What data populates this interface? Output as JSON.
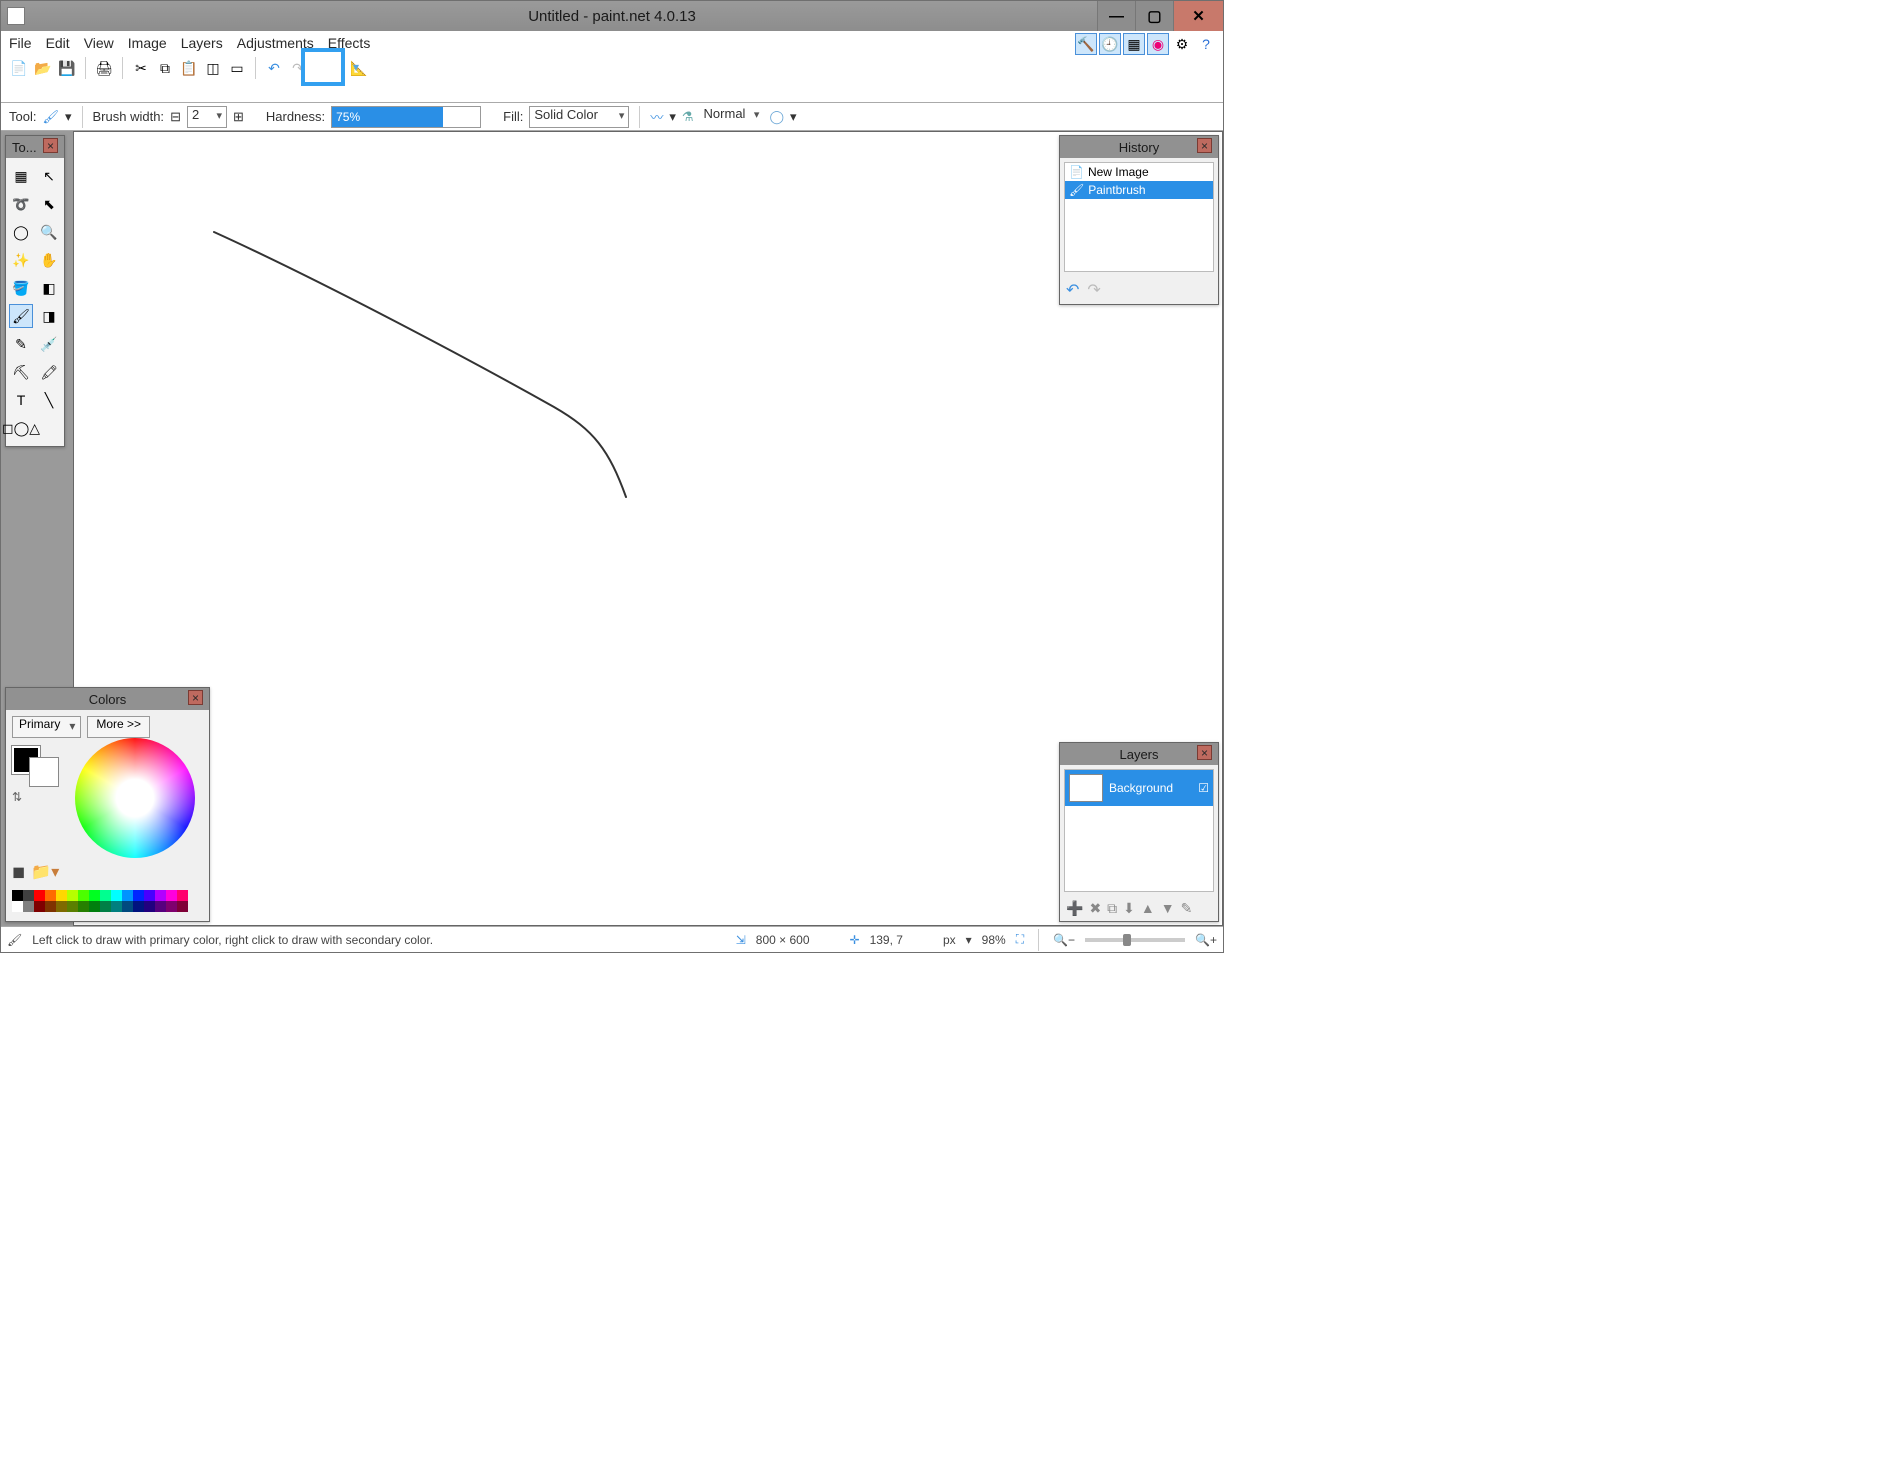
{
  "window": {
    "title": "Untitled - paint.net 4.0.13"
  },
  "menu": [
    "File",
    "Edit",
    "View",
    "Image",
    "Layers",
    "Adjustments",
    "Effects"
  ],
  "toolopts": {
    "tool_label": "Tool:",
    "brushwidth_label": "Brush width:",
    "brushwidth_value": "2",
    "hardness_label": "Hardness:",
    "hardness_value": "75%",
    "fill_label": "Fill:",
    "fill_value": "Solid Color",
    "blend_mode": "Normal"
  },
  "panels": {
    "tools_title": "To...",
    "history_title": "History",
    "colors_title": "Colors",
    "layers_title": "Layers"
  },
  "history": {
    "items": [
      {
        "label": "New Image",
        "selected": false
      },
      {
        "label": "Paintbrush",
        "selected": true
      }
    ]
  },
  "colors": {
    "dropdown": "Primary",
    "more": "More >>"
  },
  "layers": {
    "item0": "Background"
  },
  "status": {
    "hint": "Left click to draw with primary color, right click to draw with secondary color.",
    "size": "800 × 600",
    "cursor": "139, 7",
    "unit": "px",
    "zoom": "98%"
  },
  "palette_colors": [
    "#000000",
    "#404040",
    "#ff0000",
    "#ff6a00",
    "#ffd800",
    "#b6ff00",
    "#4cff00",
    "#00ff21",
    "#00ff90",
    "#00ffff",
    "#0094ff",
    "#0026ff",
    "#4800ff",
    "#b200ff",
    "#ff00dc",
    "#ff006e",
    "#ffffff",
    "#808080",
    "#7f0000",
    "#7f3300",
    "#7f6a00",
    "#5b7f00",
    "#267f00",
    "#007f0e",
    "#007f46",
    "#007f7f",
    "#004a7f",
    "#00137f",
    "#21007f",
    "#57007f",
    "#7f006e",
    "#7f0037"
  ]
}
